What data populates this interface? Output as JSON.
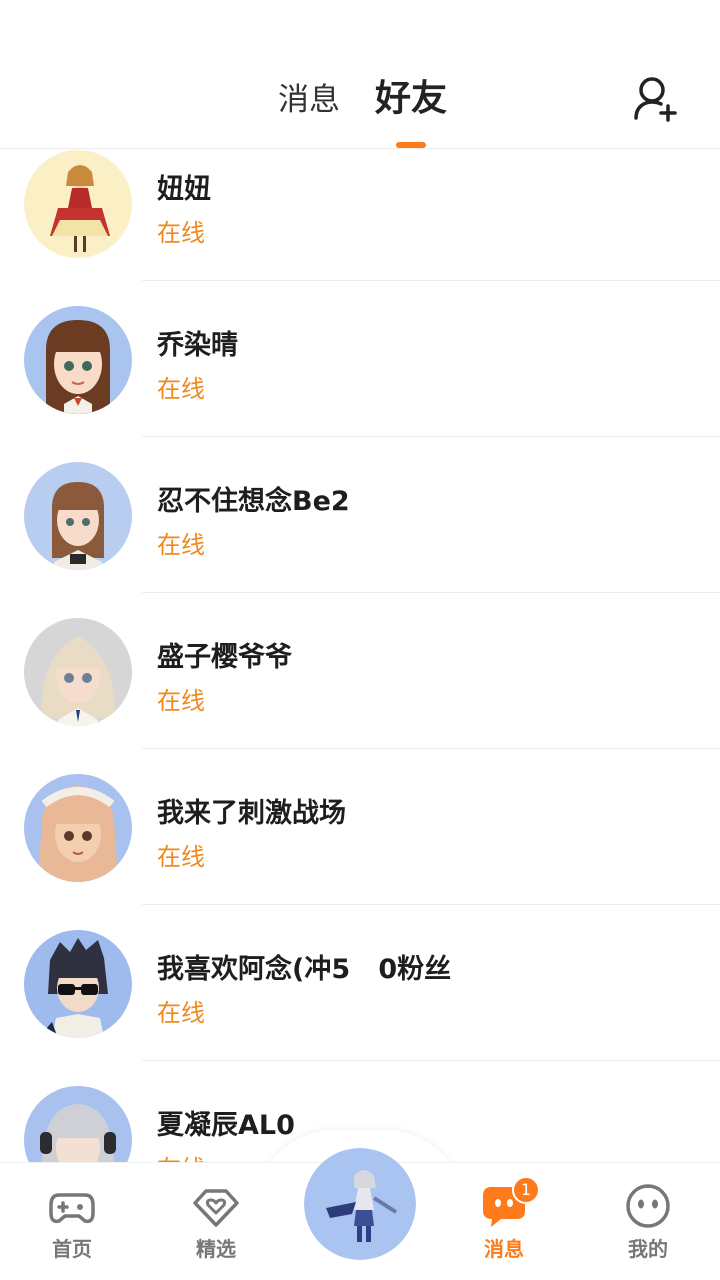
{
  "header": {
    "tabs": [
      {
        "label": "消息",
        "active": false
      },
      {
        "label": "好友",
        "active": true
      }
    ],
    "add_friend_icon": "add-user-icon",
    "accent": "#ff7a1a"
  },
  "friends": [
    {
      "name": "妞妞",
      "status": "在线"
    },
    {
      "name": "乔染晴",
      "status": "在线"
    },
    {
      "name": "忍不住想念Be2",
      "status": "在线"
    },
    {
      "name": "盛子樱爷爷",
      "status": "在线"
    },
    {
      "name": "我来了刺激战场",
      "status": "在线"
    },
    {
      "name": "我喜欢阿念(冲5   0粉丝",
      "status": "在线"
    },
    {
      "name": "夏凝辰AL0",
      "status": "在线"
    }
  ],
  "bottom_nav": {
    "items": [
      {
        "label": "首页",
        "icon": "gamepad-icon",
        "active": false
      },
      {
        "label": "精选",
        "icon": "heart-diamond-icon",
        "active": false
      },
      {
        "label": "消息",
        "icon": "chat-icon",
        "active": true,
        "badge": "1"
      },
      {
        "label": "我的",
        "icon": "face-icon",
        "active": false
      }
    ]
  }
}
